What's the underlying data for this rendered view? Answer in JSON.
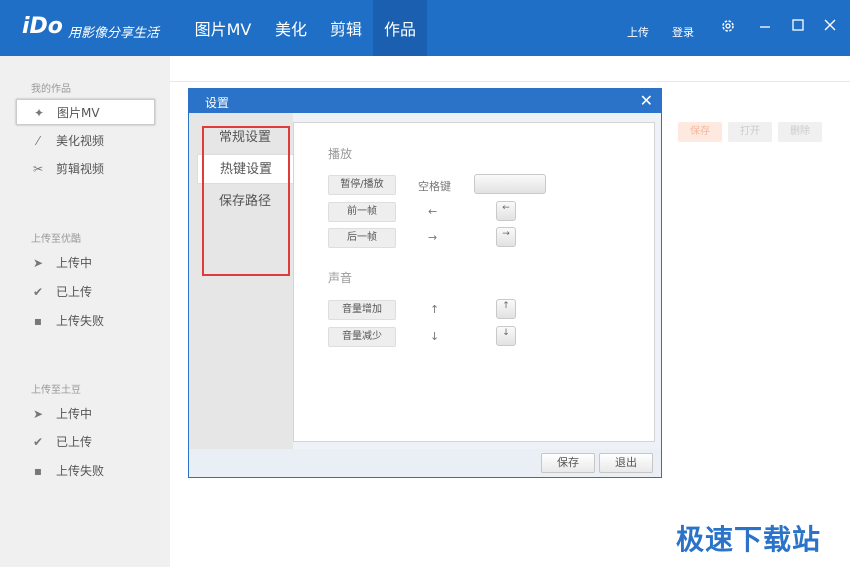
{
  "header": {
    "logo": "iDo",
    "slogan": "用影像分享生活",
    "tabs": [
      "图片MV",
      "美化",
      "剪辑",
      "作品"
    ],
    "upload": "上传",
    "login": "登录"
  },
  "sidebar": {
    "group1": "我的作品",
    "items1": [
      "图片MV",
      "美化视频",
      "剪辑视频"
    ],
    "group2": "上传至优酷",
    "items2": [
      "上传中",
      "已上传",
      "上传失败"
    ],
    "group3": "上传至土豆",
    "items3": [
      "上传中",
      "已上传",
      "上传失败"
    ]
  },
  "background_buttons": [
    "保存",
    "打开",
    "删除"
  ],
  "dialog": {
    "title": "设置",
    "menu": [
      "常规设置",
      "热键设置",
      "保存路径"
    ],
    "section_play": "播放",
    "play_rows": [
      {
        "label": "暂停/播放",
        "key": "空格键"
      },
      {
        "label": "前一帧",
        "key": "←",
        "cap": "←"
      },
      {
        "label": "后一帧",
        "key": "→",
        "cap": "→"
      }
    ],
    "section_sound": "声音",
    "sound_rows": [
      {
        "label": "音量增加",
        "key": "↑",
        "cap": "↑"
      },
      {
        "label": "音量减少",
        "key": "↓",
        "cap": "↓"
      }
    ],
    "save": "保存",
    "exit": "退出"
  },
  "watermark": "极速下载站"
}
